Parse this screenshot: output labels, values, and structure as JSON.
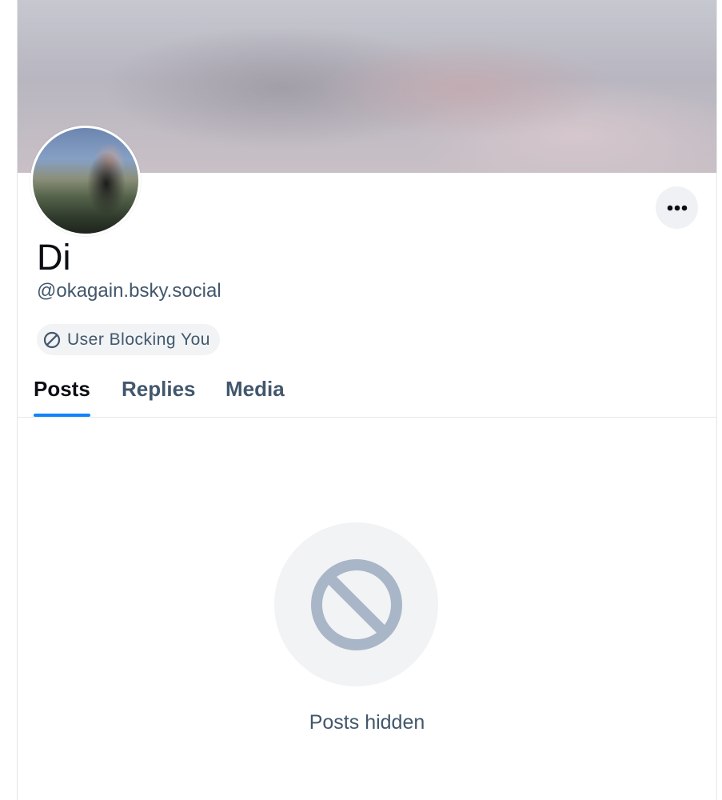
{
  "profile": {
    "display_name": "Di",
    "handle": "@okagain.bsky.social",
    "banner_image": "blurred-banner",
    "avatar_image": "blurred-avatar"
  },
  "actions": {
    "more_icon": "ellipsis-icon"
  },
  "status_pill": {
    "icon": "block-icon",
    "label": "User Blocking You"
  },
  "tabs": [
    {
      "label": "Posts",
      "active": true
    },
    {
      "label": "Replies",
      "active": false
    },
    {
      "label": "Media",
      "active": false
    }
  ],
  "empty_state": {
    "icon": "block-icon",
    "message": "Posts hidden"
  },
  "colors": {
    "accent": "#1083fe",
    "muted_text": "#42576c",
    "pill_bg": "#f1f3f5",
    "icon_gray": "#a9b6c7"
  }
}
